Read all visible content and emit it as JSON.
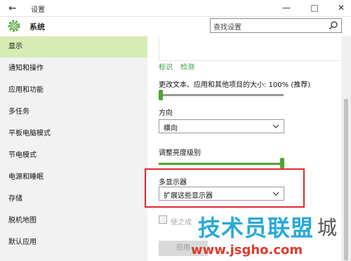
{
  "titlebar": {
    "back_icon": "back-arrow-icon",
    "title": "设置"
  },
  "header": {
    "app_icon": "gear-icon",
    "title": "系统"
  },
  "search": {
    "placeholder": "查找设置",
    "icon": "search-icon"
  },
  "sidebar": {
    "items": [
      {
        "label": "显示",
        "active": true
      },
      {
        "label": "通知和操作"
      },
      {
        "label": "应用和功能"
      },
      {
        "label": "多任务"
      },
      {
        "label": "平板电脑模式"
      },
      {
        "label": "节电模式"
      },
      {
        "label": "电源和睡眠"
      },
      {
        "label": "存储"
      },
      {
        "label": "脱机地图"
      },
      {
        "label": "默认应用"
      }
    ]
  },
  "main": {
    "link_identify": "标识",
    "link_detect": "检测",
    "scale_label": "更改文本、应用和其他项目的大小: 100% (推荐)",
    "scale_level": 0,
    "orientation_label": "方向",
    "orientation_value": "横向",
    "brightness_label": "调整亮度级别",
    "brightness_level": 1.0,
    "multi_display_label": "多显示器",
    "multi_display_value": "扩展这些显示器",
    "checkbox_label": "使之成",
    "apply_label": "应用"
  },
  "watermark": {
    "text": "技术员联盟",
    "url": "www.jsgho.com",
    "partial": "城"
  },
  "colors": {
    "accent": "#4ea22f",
    "sidebar_active": "#d6ecb4",
    "highlight_box": "#e0292f",
    "watermark_blue": "#2aa9d8",
    "watermark_red": "#e03a2c"
  }
}
